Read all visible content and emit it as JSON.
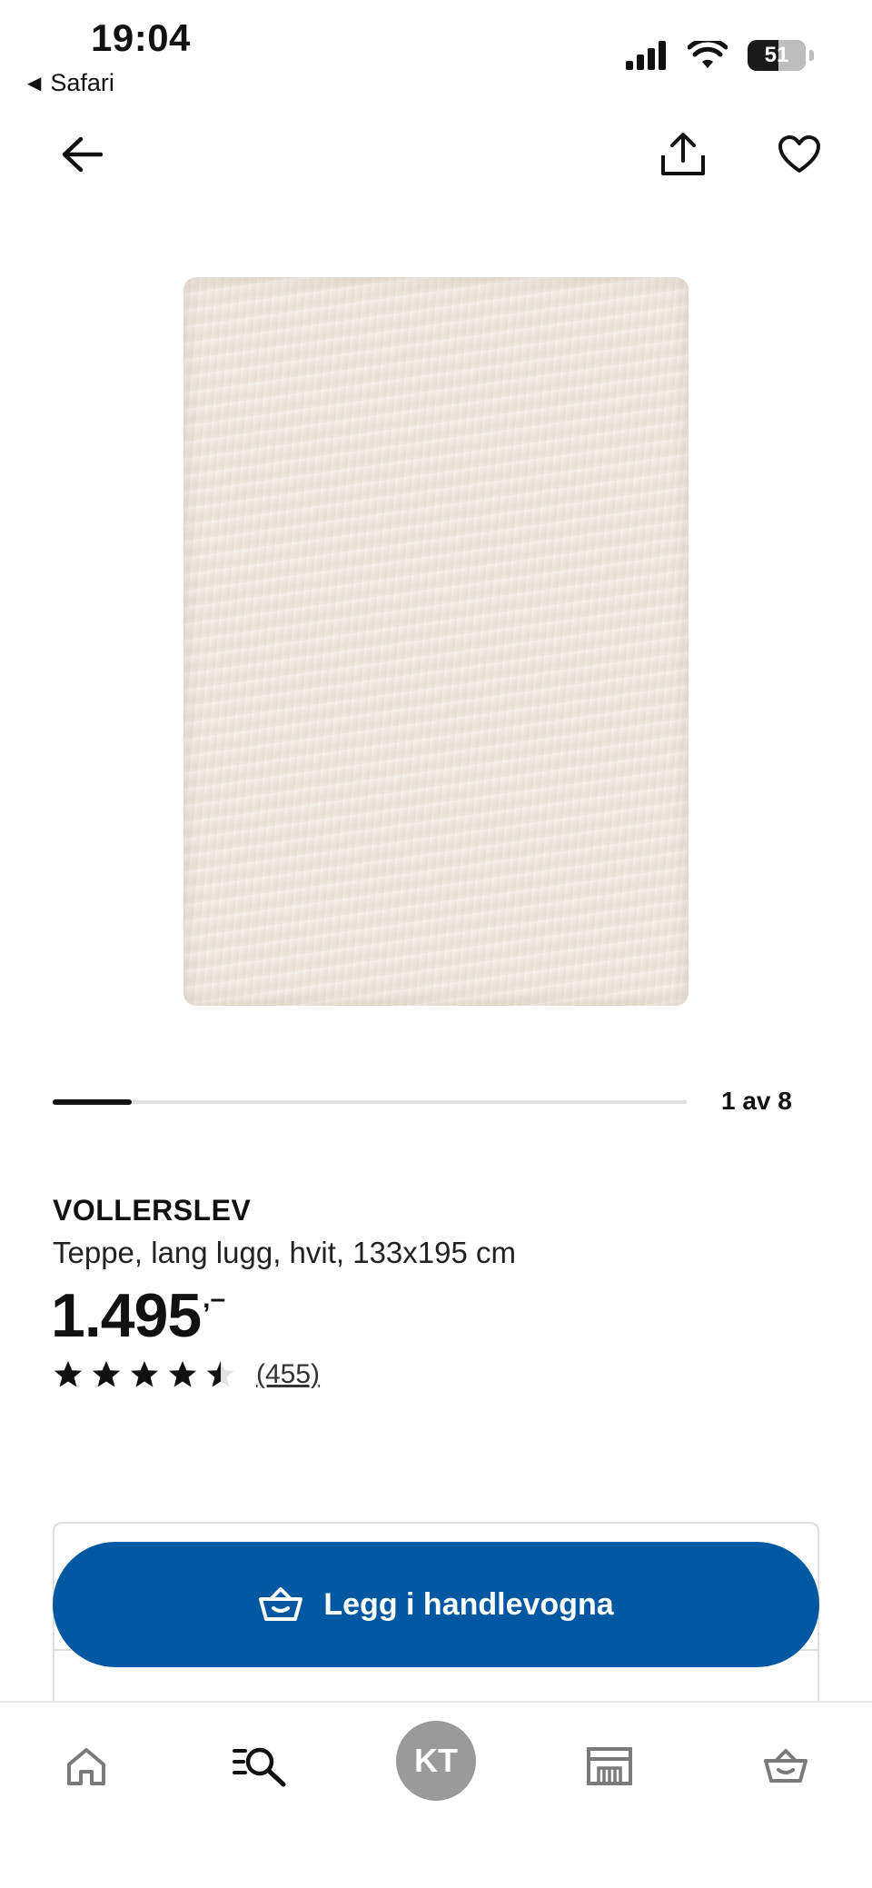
{
  "status_bar": {
    "time": "19:04",
    "back_app_label": "Safari",
    "battery_level": "51"
  },
  "nav": {
    "back_icon": "arrow-left-icon",
    "share_icon": "share-icon",
    "favorite_icon": "heart-icon"
  },
  "gallery": {
    "image_alt": "rug-image",
    "position_label": "1 av 8",
    "current": 1,
    "total": 8
  },
  "product": {
    "name": "VOLLERSLEV",
    "description": "Teppe, lang lugg, hvit, 133x195 cm",
    "price_main": "1.495",
    "price_suffix": ",–",
    "rating_value": 4.5,
    "rating_max": 5,
    "review_count": "(455)"
  },
  "actions": {
    "add_to_cart_label": "Legg i handlevogna",
    "accent_color": "#0058a3"
  },
  "tab_bar": {
    "home_icon": "home-icon",
    "search_icon": "search-list-icon",
    "profile_initials": "KT",
    "store_icon": "store-icon",
    "cart_icon": "basket-icon"
  }
}
